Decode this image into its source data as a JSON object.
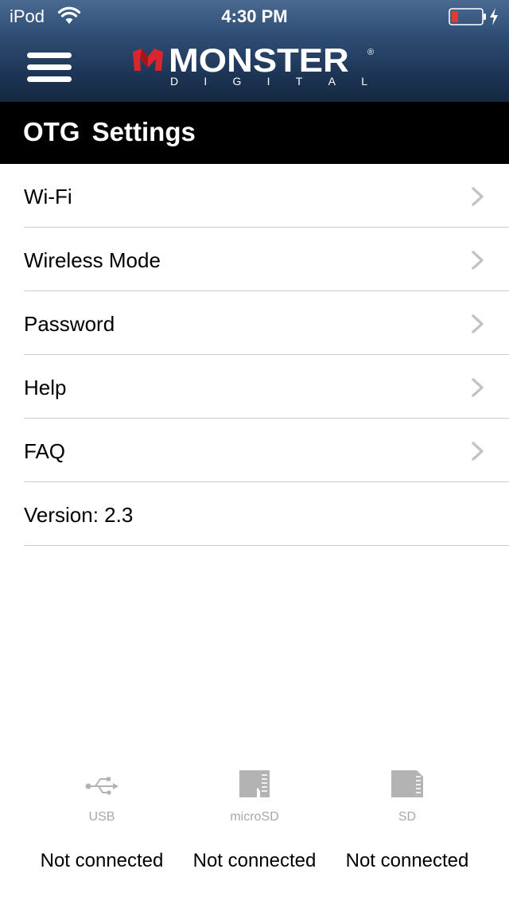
{
  "status_bar": {
    "carrier": "iPod",
    "time": "4:30 PM"
  },
  "header": {
    "brand_primary": "MONSTER",
    "brand_secondary_letters": [
      "D",
      "I",
      "G",
      "I",
      "T",
      "A",
      "L"
    ],
    "brand_reg": "®",
    "title": "OTG Settings"
  },
  "menu": {
    "items": [
      {
        "label": "Wi-Fi",
        "has_chevron": true
      },
      {
        "label": "Wireless Mode",
        "has_chevron": true
      },
      {
        "label": "Password",
        "has_chevron": true
      },
      {
        "label": "Help",
        "has_chevron": true
      },
      {
        "label": "FAQ",
        "has_chevron": true
      },
      {
        "label": "Version: 2.3",
        "has_chevron": false
      }
    ]
  },
  "devices": [
    {
      "label": "USB",
      "status": "Not connected",
      "icon": "usb-icon"
    },
    {
      "label": "microSD",
      "status": "Not connected",
      "icon": "microsd-icon"
    },
    {
      "label": "SD",
      "status": "Not connected",
      "icon": "sd-card-icon"
    }
  ],
  "colors": {
    "header_top": "#4a6a92",
    "header_bottom": "#14273f",
    "title_bar": "#000000",
    "logo_red": "#d8262e",
    "battery_red": "#e53935",
    "separator": "#cfcfcf",
    "chevron": "#c4c4c4",
    "device_icon": "#b3b3b3"
  }
}
